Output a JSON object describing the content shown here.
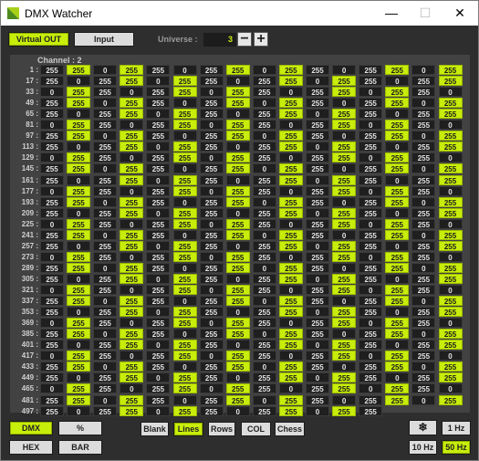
{
  "window": {
    "title": "DMX Watcher",
    "min_glyph": "—",
    "max_glyph": "☐",
    "close_glyph": "✕",
    "accent": "#c7ed0a"
  },
  "toolbar": {
    "virtual_out": "Virtual OUT",
    "input": "Input",
    "universe_label": "Universe :",
    "universe_value": "3",
    "minus": "−",
    "plus": "+"
  },
  "grid": {
    "channel_label": "Channel : 2",
    "row_labels": [
      "1 :",
      "17 :",
      "33 :",
      "49 :",
      "65 :",
      "81 :",
      "97 :",
      "113 :",
      "129 :",
      "145 :",
      "161 :",
      "177 :",
      "193 :",
      "209 :",
      "225 :",
      "241 :",
      "257 :",
      "273 :",
      "289 :",
      "305 :",
      "321 :",
      "337 :",
      "353 :",
      "369 :",
      "385 :",
      "401 :",
      "417 :",
      "433 :",
      "449 :",
      "465 :",
      "481 :",
      "497 :"
    ],
    "pattern": [
      255,
      255,
      0,
      255,
      255,
      0,
      255,
      255,
      0,
      255,
      255,
      0,
      255,
      255,
      0
    ]
  },
  "bottom": {
    "dmx": "DMX",
    "percent": "%",
    "hex": "HEX",
    "bar": "BAR",
    "blank": "Blank",
    "lines": "Lines",
    "rows": "Rows",
    "col": "COL",
    "chess": "Chess",
    "snow_icon": "❄",
    "hz1": "1 Hz",
    "hz10": "10 Hz",
    "hz50": "50 Hz"
  }
}
